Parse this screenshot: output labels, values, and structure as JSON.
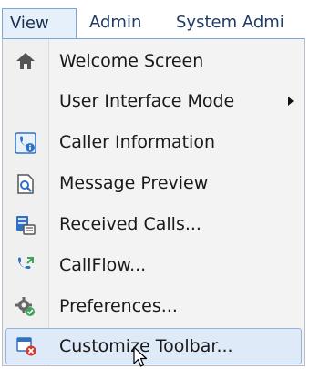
{
  "menubar": {
    "view": "View",
    "admin": "Admin",
    "system_admin": "System Admi"
  },
  "menu": {
    "items": [
      {
        "label": "Welcome Screen",
        "icon": "home-pin-icon"
      },
      {
        "label": "User Interface Mode",
        "icon": null,
        "submenu": true
      },
      {
        "label": "Caller Information",
        "icon": "caller-info-icon"
      },
      {
        "label": "Message Preview",
        "icon": "message-preview-icon"
      },
      {
        "label": "Received Calls...",
        "icon": "received-calls-icon"
      },
      {
        "label": "CallFlow...",
        "icon": "callflow-icon"
      },
      {
        "label": "Preferences...",
        "icon": "preferences-icon"
      },
      {
        "label": "Customize Toolbar...",
        "icon": "customize-toolbar-icon",
        "highlighted": true
      }
    ]
  },
  "colors": {
    "menu_text": "#1f3b66",
    "highlight_bg": "#dfeaf8",
    "highlight_border": "#8fb4e0",
    "accent_green": "#3aa655",
    "accent_red": "#d0392e",
    "icon_blue": "#2f72c4"
  }
}
